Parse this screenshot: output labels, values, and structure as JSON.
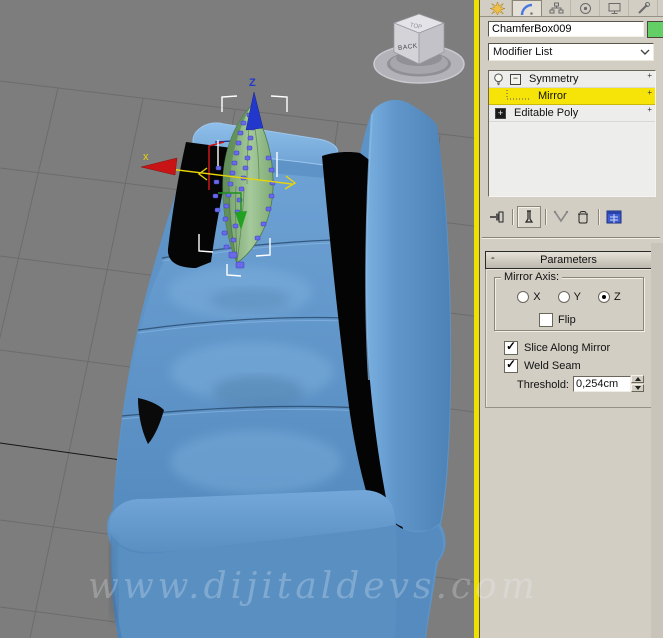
{
  "panel": {
    "tabs": [
      {
        "icon": "create-tab"
      },
      {
        "icon": "modify-tab",
        "active": true
      },
      {
        "icon": "hierarchy-tab"
      },
      {
        "icon": "motion-tab"
      },
      {
        "icon": "display-tab"
      },
      {
        "icon": "utilities-tab"
      }
    ],
    "object_name_field": {
      "value": "ChamferBox009"
    },
    "object_color": "#63ce66",
    "modifier_dropdown": {
      "value": "Modifier List"
    },
    "modifier_stack": {
      "items": [
        {
          "label": "Symmetry",
          "state": "expanded",
          "visible_toggle": "bulb"
        },
        {
          "label": "Mirror",
          "selected": true
        },
        {
          "label": "Editable Poly",
          "state": "collapsed"
        }
      ]
    },
    "stack_toolbar": [
      "pin-stack",
      "show-end-result",
      "make-unique",
      "remove-modifier",
      "configure-modifier-sets"
    ],
    "parameters": {
      "title": "Parameters",
      "mirror_axis": {
        "label": "Mirror Axis:",
        "options": [
          "X",
          "Y",
          "Z"
        ],
        "selected": "Z"
      },
      "flip": {
        "label": "Flip",
        "checked": false
      },
      "slice": {
        "label": "Slice Along Mirror",
        "checked": true
      },
      "weld": {
        "label": "Weld Seam",
        "checked": true
      },
      "threshold": {
        "label": "Threshold:",
        "value": "0,254cm"
      }
    }
  },
  "glyphs": {
    "check": "✓",
    "expand_minus": "−",
    "collapse_plus": "+",
    "rollout_minus": "-",
    "row_marker": "+"
  },
  "viewport": {
    "axis": {
      "x": "x",
      "z": "Z"
    },
    "viewcube": {
      "front": "BACK",
      "top": "TOP"
    },
    "watermark": "www.dijitaldevs.com",
    "colors": {
      "background": "#7d7d7d",
      "grid": "#6c6c6c",
      "couch": "#5d93c6",
      "object": "#86b27d",
      "active_border": "#f0e000",
      "selection_bracket": "#ffffff"
    }
  }
}
